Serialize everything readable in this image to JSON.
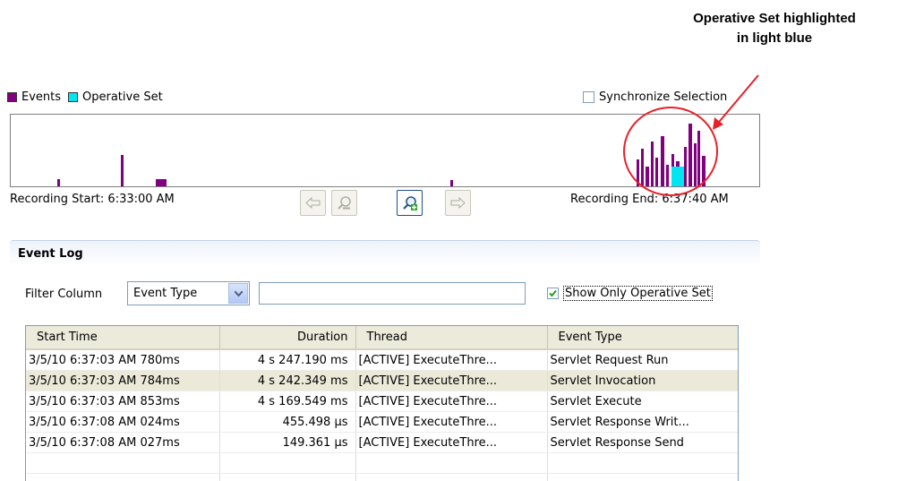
{
  "annotation": {
    "line1": "Operative Set highlighted",
    "line2": "in light blue",
    "color": "#e8202a"
  },
  "legend": {
    "items": [
      {
        "label": "Events",
        "color": "#800080"
      },
      {
        "label": "Operative Set",
        "color": "#00e5f2"
      }
    ]
  },
  "sync": {
    "label": "Synchronize Selection",
    "checked": false
  },
  "recording": {
    "start": "Recording Start: 6:33:00 AM",
    "end": "Recording End: 6:37:40 AM"
  },
  "nav_buttons": [
    {
      "name": "back-arrow-icon",
      "glyph": "⇦",
      "enabled": false
    },
    {
      "name": "zoom-out-icon",
      "glyph": "🔍",
      "enabled": false
    },
    {
      "name": "zoom-in-icon",
      "glyph": "🔍",
      "enabled": true
    },
    {
      "name": "forward-arrow-icon",
      "glyph": "⇨",
      "enabled": false
    }
  ],
  "event_log": {
    "title": "Event Log",
    "filter_label": "Filter Column",
    "filter_value": "Event Type",
    "filter_text": "",
    "show_only_label": "Show Only Operative Set",
    "show_only_checked": true,
    "columns": [
      "Start Time",
      "Duration",
      "Thread",
      "Event Type"
    ],
    "rows": [
      [
        "3/5/10 6:37:03 AM 780ms",
        "4 s 247.190 ms",
        "[ACTIVE] ExecuteThre...",
        "Servlet Request Run"
      ],
      [
        "3/5/10 6:37:03 AM 784ms",
        "4 s 242.349 ms",
        "[ACTIVE] ExecuteThre...",
        "Servlet Invocation"
      ],
      [
        "3/5/10 6:37:03 AM 853ms",
        "4 s 169.549 ms",
        "[ACTIVE] ExecuteThre...",
        "Servlet Execute"
      ],
      [
        "3/5/10 6:37:08 AM 024ms",
        "455.498 µs",
        "[ACTIVE] ExecuteThre...",
        "Servlet Response Writ..."
      ],
      [
        "3/5/10 6:37:08 AM 027ms",
        "149.361 µs",
        "[ACTIVE] ExecuteThre...",
        "Servlet Response Send"
      ]
    ],
    "selected_row": 1
  }
}
